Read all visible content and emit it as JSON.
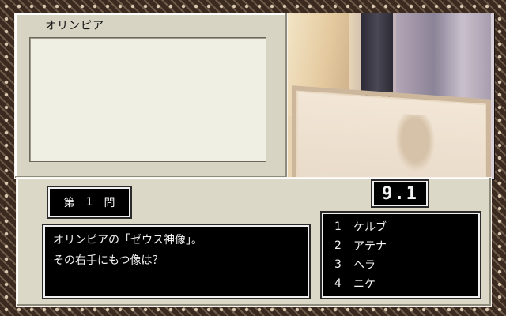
{
  "location_name": "オリンピア",
  "question": {
    "number_prefix": "第",
    "number": "1",
    "number_suffix": "問",
    "lines": [
      "オリンピアの「ゼウス神像」。",
      "その右手にもつ像は？"
    ]
  },
  "timer": "9.1",
  "choices": [
    {
      "num": "1",
      "label": "ケルブ"
    },
    {
      "num": "2",
      "label": "アテナ"
    },
    {
      "num": "3",
      "label": "ヘラ"
    },
    {
      "num": "4",
      "label": "ニケ"
    }
  ],
  "colors": {
    "panel": "#d8d4c4",
    "box_bg": "#000000",
    "box_text": "#f2f2f2",
    "frame": "#3a2a20"
  }
}
